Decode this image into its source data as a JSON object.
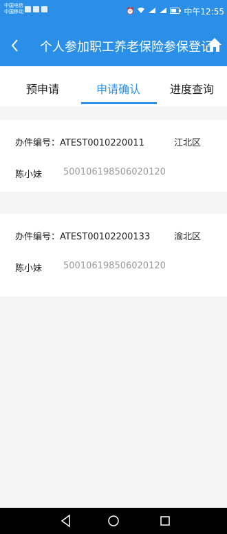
{
  "status_bar": {
    "carrier_1": "中国电信",
    "carrier_2": "中国移动",
    "time": "中午12:55"
  },
  "header": {
    "title": "个人参加职工养老保险参保登记",
    "back_icon": "chevron-left-icon",
    "home_icon": "home-icon"
  },
  "tabs": [
    {
      "label": "预申请",
      "active": false
    },
    {
      "label": "申请确认",
      "active": true
    },
    {
      "label": "进度查询",
      "active": false
    }
  ],
  "records": [
    {
      "case_no_label": "办件编号：",
      "case_no": "ATEST0010220011",
      "district": "江北区",
      "name": "陈小妹",
      "id_number": "500106198506020120"
    },
    {
      "case_no_label": "办件编号：",
      "case_no": "ATEST00102200133",
      "district": "渝北区",
      "name": "陈小妹",
      "id_number": "500106198506020120"
    }
  ],
  "colors": {
    "accent": "#2b8fe8"
  }
}
